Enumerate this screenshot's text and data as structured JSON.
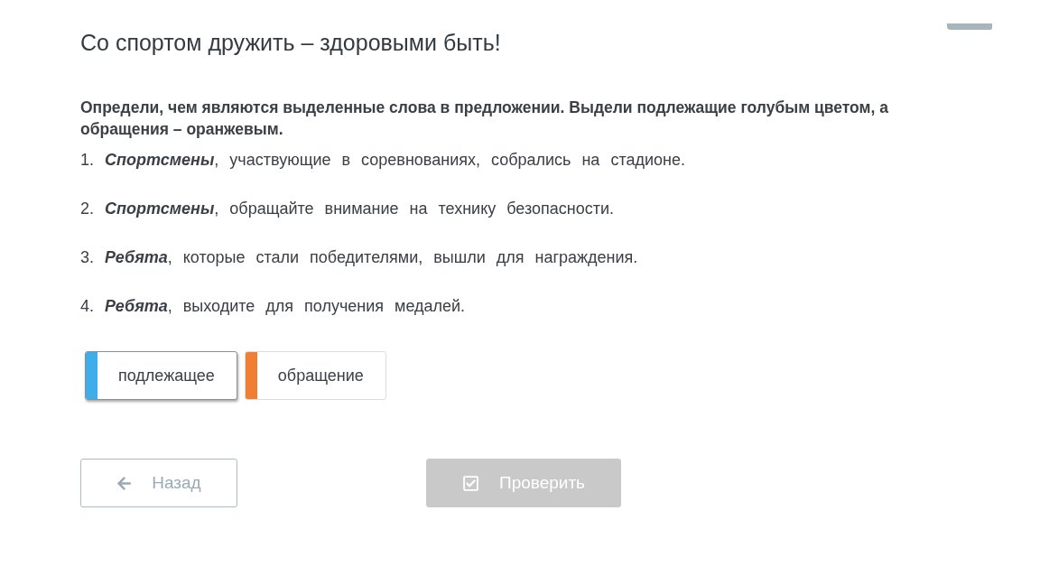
{
  "title": "Со спортом дружить – здоровыми быть!",
  "instruction": "Определи, чем являются выделенные слова в предложении. Выдели подлежащие голубым цветом, а обращения – оранжевым.",
  "sentences": [
    {
      "number": "1.",
      "text": "**Спортсмены**, участвующие в соревнованиях, собрались на стадионе."
    },
    {
      "number": "2.",
      "text": "**Спортсмены**, обращайте внимание на технику безопасности."
    },
    {
      "number": "3.",
      "text": "**Ребята**, которые стали победителями, вышли для награждения."
    },
    {
      "number": "4.",
      "text": "**Ребята**, выходите для получения медалей."
    }
  ],
  "markers": [
    {
      "label": "подлежащее",
      "color": "#3daee9",
      "selected": true
    },
    {
      "label": "обращение",
      "color": "#f07f33",
      "selected": false
    }
  ],
  "buttons": [
    {
      "kind": "back",
      "label": "Назад",
      "disabled": false
    },
    {
      "kind": "check",
      "label": "Проверить",
      "disabled": true
    }
  ]
}
